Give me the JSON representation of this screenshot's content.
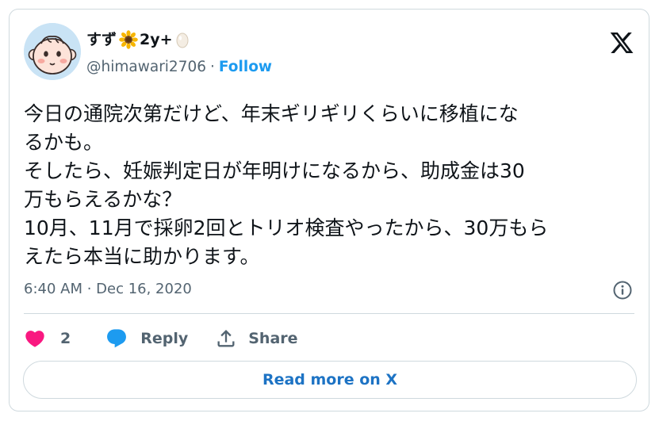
{
  "author": {
    "display_name": "すず",
    "badge_text": "2y+",
    "handle": "@himawari2706",
    "separator": "·",
    "follow_label": "Follow"
  },
  "tweet": {
    "lines": [
      "今日の通院次第だけど、年末ギリギリくらいに移植にな",
      "るかも。",
      "そしたら、妊娠判定日が年明けになるから、助成金は30",
      "万もらえるかな？",
      "10月、11月で採卵2回とトリオ検査やったから、30万もら",
      "えたら本当に助かります。"
    ],
    "timestamp": "6:40 AM · Dec 16, 2020"
  },
  "actions": {
    "like_count": "2",
    "reply_label": "Reply",
    "share_label": "Share"
  },
  "read_more_label": "Read more on X",
  "colors": {
    "accent": "#1d9bf0",
    "heart": "#f91880",
    "secondary_text": "#536471",
    "border": "#cfd9de"
  },
  "icons": [
    "sunflower-icon",
    "egg-icon",
    "x-logo-icon",
    "info-icon",
    "heart-icon",
    "reply-bubble-icon",
    "share-icon"
  ]
}
